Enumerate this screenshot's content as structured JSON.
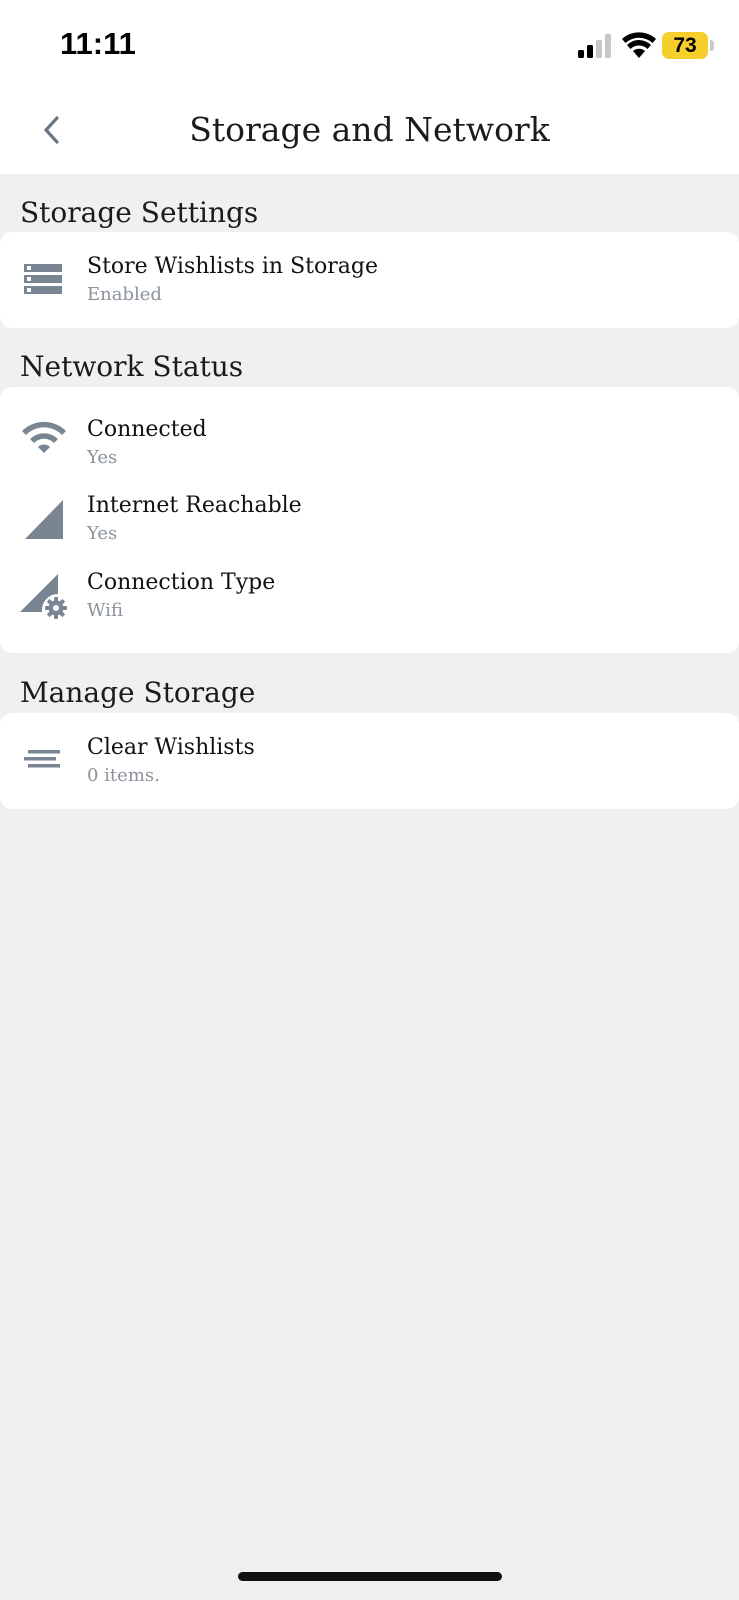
{
  "status_bar": {
    "time": "11:11",
    "battery": "73",
    "battery_color": "#f6cf2a"
  },
  "header": {
    "title": "Storage and Network",
    "back_icon": "chevron-left-icon"
  },
  "sections": {
    "storage_settings": {
      "title": "Storage Settings",
      "items": [
        {
          "icon": "storage-icon",
          "label": "Store Wishlists in Storage",
          "value": "Enabled"
        }
      ]
    },
    "network_status": {
      "title": "Network Status",
      "items": [
        {
          "icon": "wifi-icon",
          "label": "Connected",
          "value": "Yes"
        },
        {
          "icon": "signal-cellular-icon",
          "label": "Internet Reachable",
          "value": "Yes"
        },
        {
          "icon": "signal-settings-icon",
          "label": "Connection Type",
          "value": "Wifi"
        }
      ]
    },
    "manage_storage": {
      "title": "Manage Storage",
      "items": [
        {
          "icon": "notes-icon",
          "label": "Clear Wishlists",
          "value": "0 items."
        }
      ]
    }
  },
  "colors": {
    "icon": "#7a8594",
    "background": "#f0f0f0",
    "card": "#ffffff"
  }
}
